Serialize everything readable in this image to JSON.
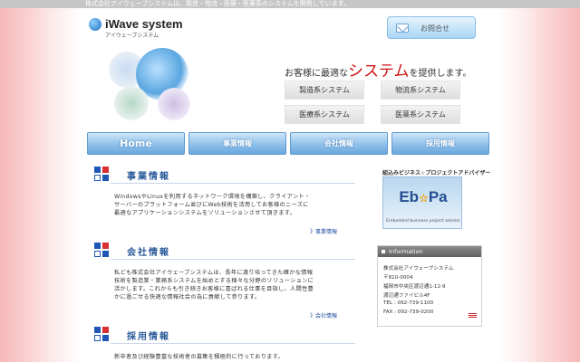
{
  "topbar": {
    "text": "株式会社アイウェーブシステムは、製造・物流・医療・医薬系のシステムを開発しています。"
  },
  "header": {
    "logo_name": "iWave system",
    "logo_kana": "アイウェーブシステム",
    "contact_label": "お問合せ"
  },
  "hero": {
    "tagline_pre": "お客様に最適な",
    "tagline_em": "システム",
    "tagline_post": "を提供します。",
    "systems": [
      "製造系システム",
      "物流系システム",
      "医療系システム",
      "医薬系システム"
    ]
  },
  "nav": {
    "items": [
      "Home",
      "事業情報",
      "会社情報",
      "採用情報"
    ]
  },
  "sections": [
    {
      "title": "事業情報",
      "lines": [
        "WindowsやLinuxを利用するネットワーク環境を構築し、クライアント・",
        "サーバーのプラットフォーム並びにWeb技術を活用してお客様のニーズに",
        "最適なアプリケーションシステムをソリューションさせて頂きます。"
      ],
      "link": "》事業情報"
    },
    {
      "title": "会社情報",
      "lines": [
        "私ども株式会社アイウェーブシステムは、長年に渡り培ってきた確かな情報",
        "技術を製造業・業務系システムを始めとする様々な分野のソリューションに",
        "活かします。これからも引き続きお客様に喜ばれる仕事を目指し、人間性豊",
        "かに過ごせる快適な情報社会の為に貢献して参ります。"
      ],
      "link": "》会社情報"
    },
    {
      "title": "採用情報",
      "lines": [
        "新卒者及び経験豊富な技術者の募集を積極的に行っております。"
      ]
    }
  ],
  "ebpa": {
    "heading": "組込みビジネス☆プロジェクトアドバイザー",
    "logo_left": "Eb",
    "logo_star": "☆",
    "logo_right": "Pa",
    "subtitle": "Embedded  business  project  advisor"
  },
  "info": {
    "heading": "Information",
    "company": "株式会社アイウェーブシステム",
    "postal": "〒810-0004",
    "address1": "福岡市中央区渡辺通1-12-9",
    "address2": "渡辺通ファイビル4F",
    "tel": "TEL : 092-739-1100",
    "fax": "FAX : 092-739-0200"
  }
}
